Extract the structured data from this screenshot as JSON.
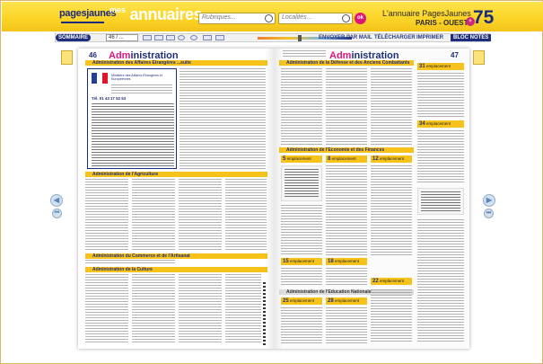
{
  "header": {
    "logo_pagesjaunes": "pagesjaunes",
    "logo_mes": "mes",
    "logo_annuaires": "annuaires",
    "search_rubriques_placeholder": "Rubriques...",
    "search_localites_placeholder": "Localités...",
    "ok_label": "ok",
    "brand_title": "L'annuaire PagesJaunes",
    "brand_region": "PARIS - OUEST",
    "brand_number": "75",
    "brand_badge": "+"
  },
  "toolbar": {
    "sommaire_label": "SOMMAIRE",
    "page_value": "46 / ...",
    "envoyer_label": "ENVOYER PAR MAIL",
    "telecharger_label": "TÉLÉCHARGER",
    "imprimer_label": "IMPRIMER",
    "bloc_notes_label": "BLOC NOTES",
    "zoom_percent": 45
  },
  "left_page": {
    "number": "46",
    "title_prefix": "Adm",
    "title_rest": "inistration",
    "sections": [
      "Administration des Affaires Étrangères ...suite",
      "Administration de l'Agriculture",
      "Administration du Commerce et de l'Artisanat",
      "Administration de la Culture"
    ],
    "ministry_box_title": "Ministère des Affaires Étrangères et Européennes",
    "ministry_box_phone": "Tél. 01 43 17 53 53"
  },
  "right_page": {
    "number": "47",
    "title_prefix": "Adm",
    "title_rest": "inistration",
    "sections": [
      "Administration de la Défense et des Anciens Combattants",
      "Administration de l'Économie et des Finances",
      "Administration de l'Éducation Nationale"
    ],
    "emplacement_label": "emplacement",
    "emplacement_numbers": [
      "5",
      "8",
      "12",
      "15",
      "18",
      "22",
      "25",
      "28",
      "31",
      "34"
    ]
  },
  "nav": {
    "prev_icon": "chevron-left-icon",
    "next_icon": "chevron-right-icon",
    "first_icon": "skip-first-icon",
    "last_icon": "skip-last-icon"
  }
}
